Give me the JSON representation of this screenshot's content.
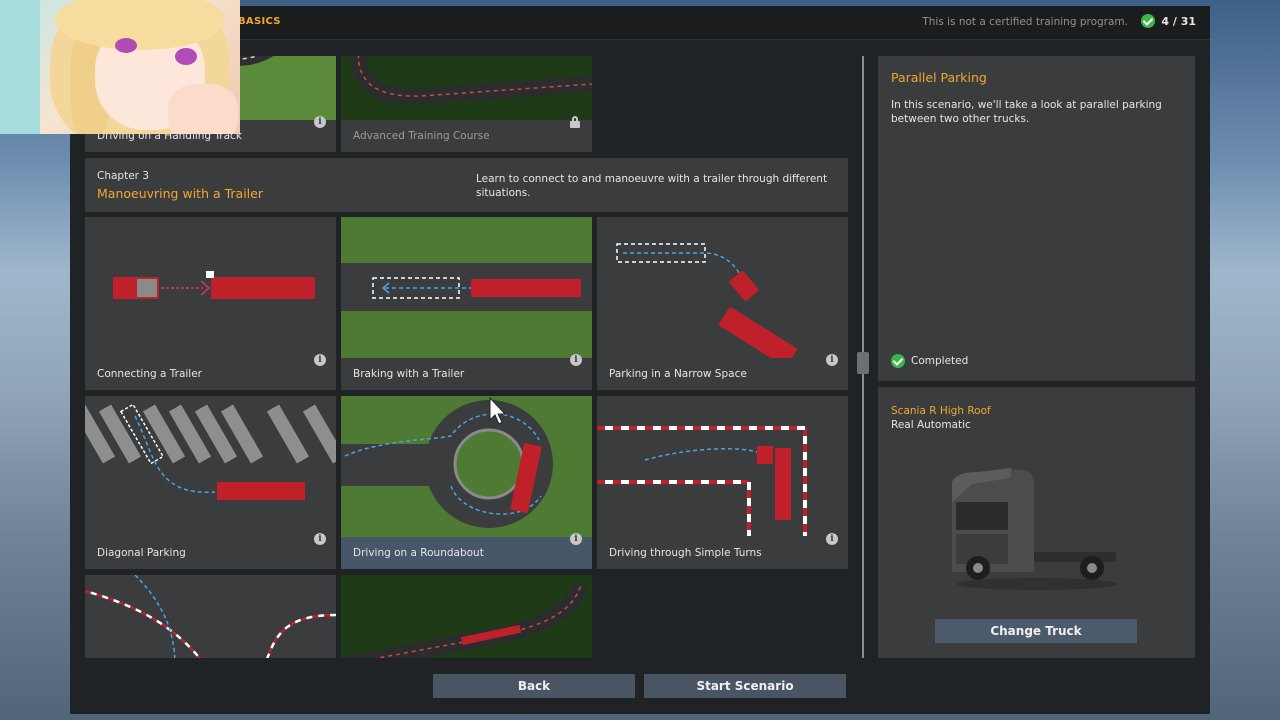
{
  "breadcrumb": "BASICS",
  "disclaimer": "This is not a certified training program.",
  "progress": "4 / 31",
  "top_tiles": [
    {
      "label": "Driving on a Handling Track",
      "locked": false
    },
    {
      "label": "Advanced Training Course",
      "locked": true
    }
  ],
  "chapter": {
    "number": "Chapter 3",
    "title": "Manoeuvring with a Trailer",
    "description": "Learn to connect to and manoeuvre with a trailer through different situations."
  },
  "tiles": [
    {
      "label": "Connecting a Trailer"
    },
    {
      "label": "Braking with a Trailer"
    },
    {
      "label": "Parking in a Narrow Space"
    },
    {
      "label": "Diagonal Parking"
    },
    {
      "label": "Driving on a Roundabout"
    },
    {
      "label": "Driving through Simple Turns"
    }
  ],
  "scenario": {
    "title": "Parallel Parking",
    "description": "In this scenario, we'll take a look at parallel parking between two other trucks.",
    "status": "Completed"
  },
  "truck": {
    "name": "Scania R High Roof",
    "transmission": "Real Automatic",
    "change_label": "Change Truck"
  },
  "buttons": {
    "back": "Back",
    "start": "Start Scenario"
  },
  "colors": {
    "accent": "#f2a931",
    "panel": "#3a3c3e",
    "background": "#202325",
    "completed": "#3cb54a",
    "button": "#4a5563"
  }
}
